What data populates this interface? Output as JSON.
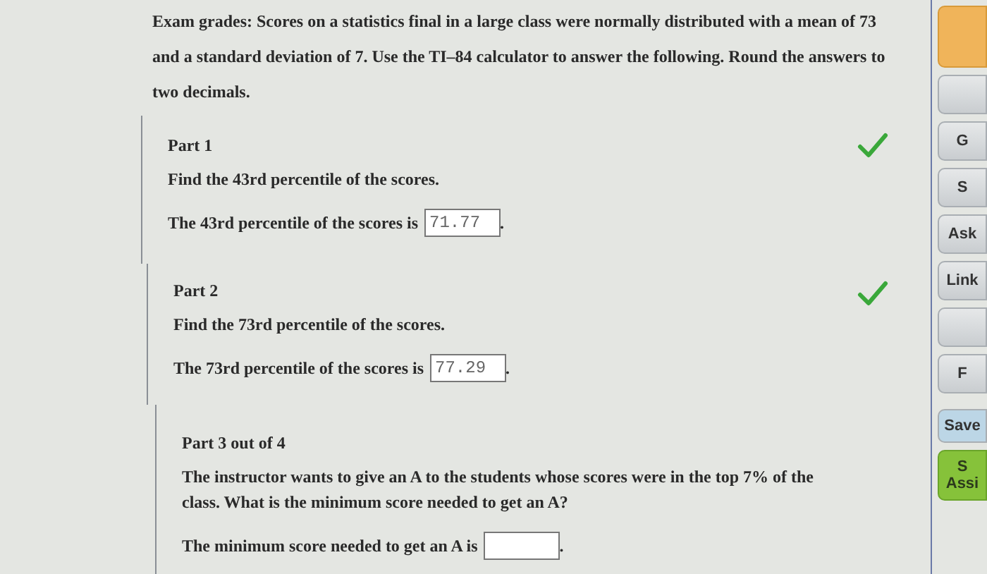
{
  "intro": "Exam grades: Scores on a statistics final in a large class were normally distributed with a mean of 73 and a standard deviation of 7. Use the TI–84 calculator to answer the following. Round the answers to two decimals.",
  "parts": [
    {
      "title": "Part 1",
      "question": "Find the 43rd percentile of the scores.",
      "answer_label": "The 43rd percentile of the scores is",
      "answer_value": "71.77",
      "answer_end": ".",
      "correct": true
    },
    {
      "title": "Part 2",
      "question": "Find the 73rd percentile of the scores.",
      "answer_label": "The 73rd percentile of the scores is",
      "answer_value": "77.29",
      "answer_end": ".",
      "correct": true
    },
    {
      "title": "Part 3 out of 4",
      "question": "The instructor wants to give an A to the students whose scores were in the top 7% of the class. What is the minimum score needed to get an A?",
      "answer_label": "The minimum score needed to get an A is",
      "answer_end": ".",
      "correct": false
    }
  ],
  "sidebar": [
    {
      "kind": "orange"
    },
    {
      "kind": "plain"
    },
    {
      "kind": "plain",
      "lines": [
        "G"
      ]
    },
    {
      "kind": "plain",
      "lines": [
        "S"
      ]
    },
    {
      "kind": "plain",
      "lines": [
        "Ask"
      ]
    },
    {
      "kind": "plain",
      "lines": [
        "Link"
      ]
    },
    {
      "kind": "plain"
    },
    {
      "kind": "plain",
      "lines": [
        "F"
      ]
    },
    {
      "kind": "save",
      "lines": [
        "Save"
      ]
    },
    {
      "kind": "green",
      "lines": [
        "S",
        "Assi"
      ]
    }
  ]
}
